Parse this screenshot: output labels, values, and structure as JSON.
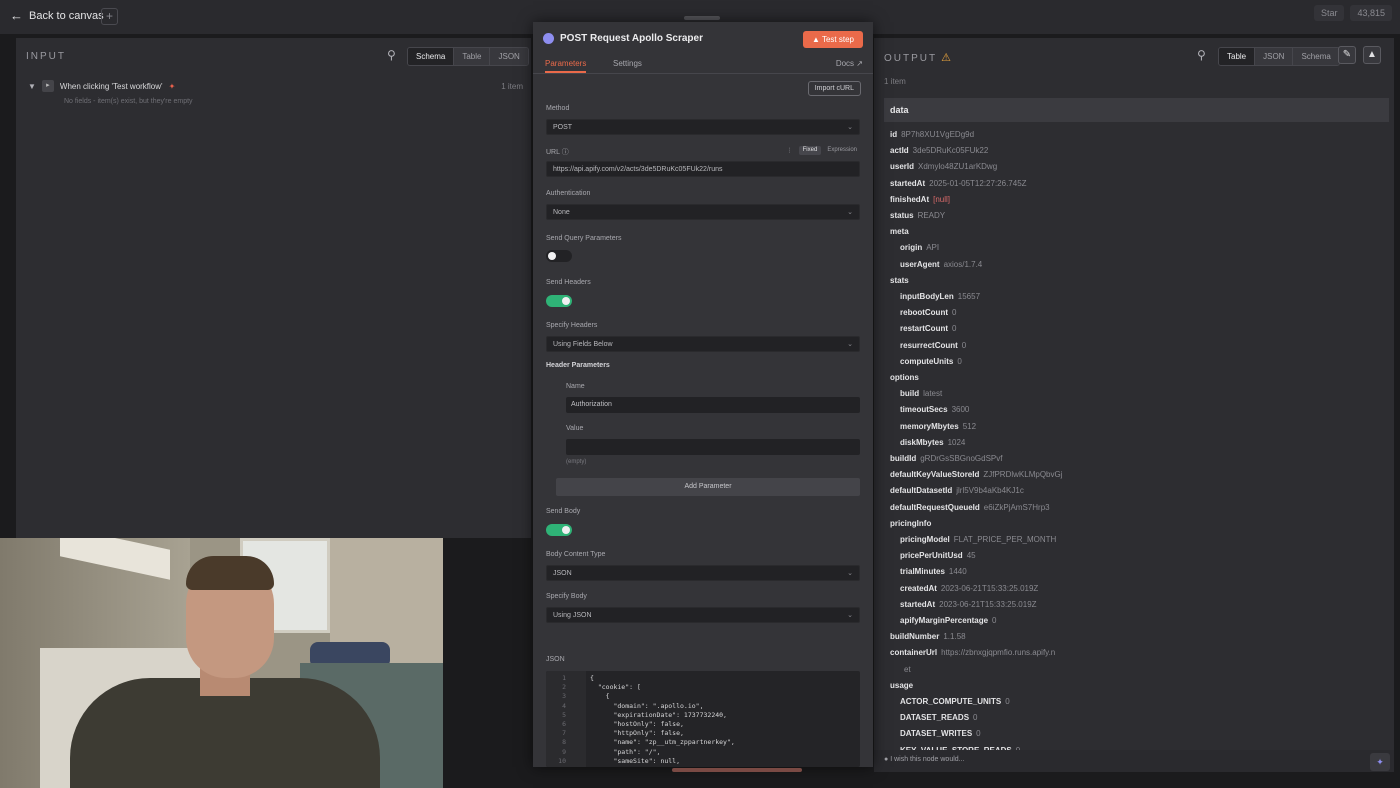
{
  "topbar": {
    "back_label": "Back to canvas",
    "add_label": "+",
    "right_buttons": [
      "Star",
      "43,815"
    ]
  },
  "input_panel": {
    "title": "INPUT",
    "tabs": [
      "Schema",
      "Table",
      "JSON"
    ],
    "active_tab": "Schema",
    "trigger": {
      "name": "When clicking 'Test workflow'",
      "count": "1 item",
      "note": "No fields - item(s) exist, but they're empty"
    }
  },
  "node": {
    "title": "POST Request Apollo Scraper",
    "test_button": "Test step",
    "tabs": [
      "Parameters",
      "Settings"
    ],
    "docs_label": "Docs",
    "import_curl": "Import cURL",
    "method": {
      "label": "Method",
      "value": "POST"
    },
    "url": {
      "label": "URL",
      "value": "https://api.apify.com/v2/acts/3de5DRuKc05FUk22/runs",
      "modes": [
        "Fixed",
        "Expression"
      ]
    },
    "authentication": {
      "label": "Authentication",
      "value": "None"
    },
    "send_query": {
      "label": "Send Query Parameters",
      "on": false
    },
    "send_headers": {
      "label": "Send Headers",
      "on": true
    },
    "specify_headers": {
      "label": "Specify Headers",
      "value": "Using Fields Below"
    },
    "header_params": {
      "label": "Header Parameters",
      "name_label": "Name",
      "name_value": "Authorization",
      "value_label": "Value",
      "value_value": "",
      "empty_note": "(empty)",
      "add_button": "Add Parameter"
    },
    "send_body": {
      "label": "Send Body",
      "on": true
    },
    "body_content_type": {
      "label": "Body Content Type",
      "value": "JSON"
    },
    "specify_body": {
      "label": "Specify Body",
      "value": "Using JSON"
    },
    "json": {
      "label": "JSON",
      "lines": [
        {
          "n": "1",
          "text": "{"
        },
        {
          "n": "2",
          "text": "  \"cookie\": ["
        },
        {
          "n": "3",
          "text": "    {"
        },
        {
          "n": "4",
          "text": "      \"domain\": \".apollo.io\","
        },
        {
          "n": "5",
          "text": "      \"expirationDate\": 1737732240,"
        },
        {
          "n": "6",
          "text": "      \"hostOnly\": false,"
        },
        {
          "n": "7",
          "text": "      \"httpOnly\": false,"
        },
        {
          "n": "8",
          "text": "      \"name\": \"zp__utm_zppartnerkey\","
        },
        {
          "n": "9",
          "text": "      \"path\": \"/\","
        },
        {
          "n": "10",
          "text": "      \"sameSite\": null,"
        }
      ]
    }
  },
  "output_panel": {
    "title": "OUTPUT",
    "tabs": [
      "Table",
      "JSON",
      "Schema"
    ],
    "active_tab": "Table",
    "items_count": "1 item",
    "data_header": "data",
    "rows": [
      {
        "indent": 0,
        "key": "id",
        "value": "8P7h8XU1VgEDg9d"
      },
      {
        "indent": 0,
        "key": "actId",
        "value": "3de5DRuKc05FUk22"
      },
      {
        "indent": 0,
        "key": "userId",
        "value": "Xdmylo48ZU1arKDwg"
      },
      {
        "indent": 0,
        "key": "startedAt",
        "value": "2025-01-05T12:27:26.745Z"
      },
      {
        "indent": 0,
        "key": "finishedAt",
        "value": "[null]",
        "null": true
      },
      {
        "indent": 0,
        "key": "status",
        "value": "READY"
      },
      {
        "indent": 0,
        "key": "meta",
        "value": ""
      },
      {
        "indent": 1,
        "key": "origin",
        "value": "API"
      },
      {
        "indent": 1,
        "key": "userAgent",
        "value": "axios/1.7.4"
      },
      {
        "indent": 0,
        "key": "stats",
        "value": ""
      },
      {
        "indent": 1,
        "key": "inputBodyLen",
        "value": "15657"
      },
      {
        "indent": 1,
        "key": "rebootCount",
        "value": "0"
      },
      {
        "indent": 1,
        "key": "restartCount",
        "value": "0"
      },
      {
        "indent": 1,
        "key": "resurrectCount",
        "value": "0"
      },
      {
        "indent": 1,
        "key": "computeUnits",
        "value": "0"
      },
      {
        "indent": 0,
        "key": "options",
        "value": ""
      },
      {
        "indent": 1,
        "key": "build",
        "value": "latest"
      },
      {
        "indent": 1,
        "key": "timeoutSecs",
        "value": "3600"
      },
      {
        "indent": 1,
        "key": "memoryMbytes",
        "value": "512"
      },
      {
        "indent": 1,
        "key": "diskMbytes",
        "value": "1024"
      },
      {
        "indent": 0,
        "key": "buildId",
        "value": "gRDrGsSBGnoGdSPvf"
      },
      {
        "indent": 0,
        "key": "defaultKeyValueStoreId",
        "value": "ZJfPRDlwKLMpQbvGj"
      },
      {
        "indent": 0,
        "key": "defaultDatasetId",
        "value": "jlrl5V9b4aKb4KJ1c"
      },
      {
        "indent": 0,
        "key": "defaultRequestQueueId",
        "value": "e6iZkPjAmS7Hrp3"
      },
      {
        "indent": 0,
        "key": "pricingInfo",
        "value": ""
      },
      {
        "indent": 1,
        "key": "pricingModel",
        "value": "FLAT_PRICE_PER_MONTH"
      },
      {
        "indent": 1,
        "key": "pricePerUnitUsd",
        "value": "45"
      },
      {
        "indent": 1,
        "key": "trialMinutes",
        "value": "1440"
      },
      {
        "indent": 1,
        "key": "createdAt",
        "value": "2023-06-21T15:33:25.019Z"
      },
      {
        "indent": 1,
        "key": "startedAt",
        "value": "2023-06-21T15:33:25.019Z"
      },
      {
        "indent": 1,
        "key": "apifyMarginPercentage",
        "value": "0"
      },
      {
        "indent": 0,
        "key": "buildNumber",
        "value": "1.1.58"
      },
      {
        "indent": 0,
        "key": "containerUrl",
        "value": "https://zbnxgjqpmfio.runs.apify.n"
      },
      {
        "indent": 1,
        "key": "",
        "value": "et"
      },
      {
        "indent": 0,
        "key": "usage",
        "value": ""
      },
      {
        "indent": 1,
        "key": "ACTOR_COMPUTE_UNITS",
        "value": "0"
      },
      {
        "indent": 1,
        "key": "DATASET_READS",
        "value": "0"
      },
      {
        "indent": 1,
        "key": "DATASET_WRITES",
        "value": "0"
      },
      {
        "indent": 1,
        "key": "KEY_VALUE_STORE_READS",
        "value": "0"
      }
    ],
    "footer_text": "I wish this node would..."
  }
}
